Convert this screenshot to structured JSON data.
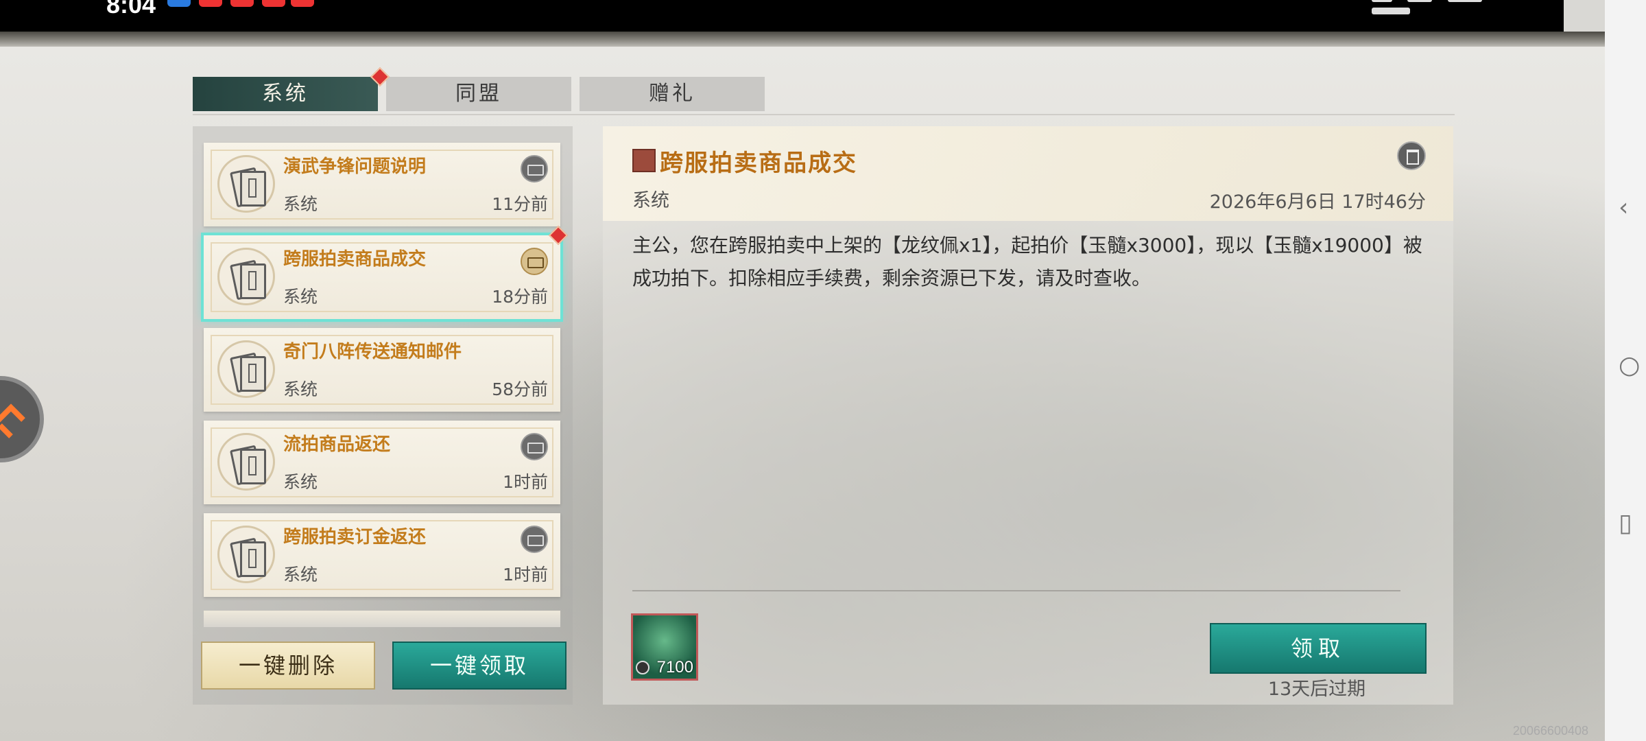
{
  "status_bar": {
    "time": "8:04"
  },
  "tabs": [
    {
      "label": "系统",
      "active": true
    },
    {
      "label": "同盟",
      "active": false
    },
    {
      "label": "赠礼",
      "active": false
    }
  ],
  "mail_list": [
    {
      "title": "演武争锋问题说明",
      "sender": "系统",
      "time": "11分前"
    },
    {
      "title": "跨服拍卖商品成交",
      "sender": "系统",
      "time": "18分前"
    },
    {
      "title": "奇门八阵传送通知邮件",
      "sender": "系统",
      "time": "58分前"
    },
    {
      "title": "流拍商品返还",
      "sender": "系统",
      "time": "1时前"
    },
    {
      "title": "跨服拍卖订金返还",
      "sender": "系统",
      "time": "1时前"
    }
  ],
  "buttons": {
    "delete_all": "一键删除",
    "claim_all": "一键领取",
    "claim": "领取"
  },
  "detail": {
    "title": "跨服拍卖商品成交",
    "sender": "系统",
    "date": "2026年6月6日 17时46分",
    "body": "主公，您在跨服拍卖中上架的【龙纹佩x1】，起拍价【玉髓x3000】，现以【玉髓x19000】被成功拍下。扣除相应手续费，剩余资源已下发，请及时查收。",
    "reward_qty": "7100",
    "expire": "13天后过期"
  },
  "watermark": "20066600408",
  "colors": {
    "accent_teal": "#16786e",
    "title_gold": "#c37c1c",
    "alert_red": "#d33333"
  }
}
